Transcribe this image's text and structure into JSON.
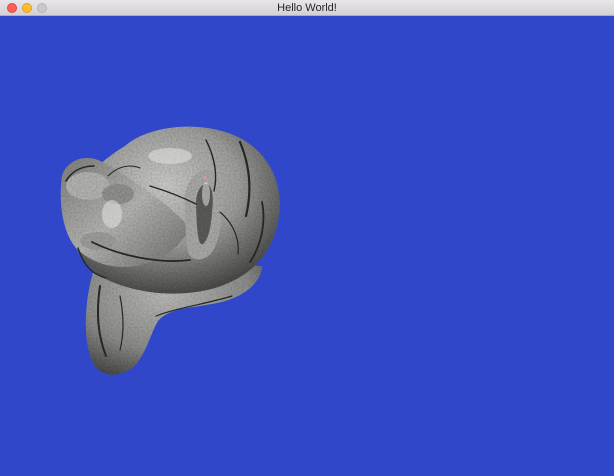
{
  "window": {
    "title": "Hello World!"
  },
  "colors": {
    "background": "#3047c9",
    "titlebar": "#dddcdd",
    "close_button": "#fe5f57",
    "minimize_button": "#febc2e",
    "zoom_button": "#c9c8c9",
    "model_base": "#9a9a98",
    "model_shadow": "#3d3d3b"
  },
  "scene": {
    "object": "stone-textured-3d-model"
  }
}
